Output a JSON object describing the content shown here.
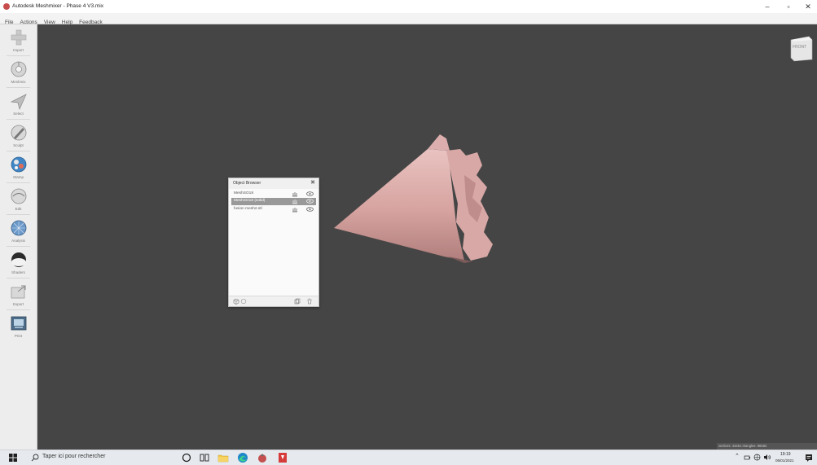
{
  "window": {
    "title": "Autodesk Meshmixer - Phase 4 V3.mix",
    "controls": [
      "–",
      "▫",
      "✕"
    ]
  },
  "menu": [
    "File",
    "Actions",
    "View",
    "Help",
    "Feedback"
  ],
  "tools": [
    {
      "label": "Import",
      "icon": "import-icon"
    },
    {
      "label": "Meshmix",
      "icon": "meshmix-icon"
    },
    {
      "label": "Select",
      "icon": "select-icon"
    },
    {
      "label": "Sculpt",
      "icon": "sculpt-icon"
    },
    {
      "label": "Stamp",
      "icon": "stamp-icon"
    },
    {
      "label": "Edit",
      "icon": "edit-icon"
    },
    {
      "label": "Analysis",
      "icon": "analysis-icon"
    },
    {
      "label": "Shaders",
      "icon": "shaders-icon"
    },
    {
      "label": "Export",
      "icon": "export-icon"
    },
    {
      "label": "Print",
      "icon": "print-icon"
    }
  ],
  "viewcube": {
    "label": "FRONT"
  },
  "object_browser": {
    "title": "Object Browser",
    "items": [
      {
        "name": "MeshSO18",
        "selected": false
      },
      {
        "name": "MeshSO18 (solid)",
        "selected": true
      },
      {
        "name": "fusion mesh2.stl",
        "selected": false
      }
    ]
  },
  "status": {
    "text": "vertices: 43451 triangles: 86582"
  },
  "taskbar": {
    "search_placeholder": "Taper ici pour rechercher",
    "time": "19:19",
    "date": "05/01/2021"
  },
  "colors": {
    "viewport": "#454545",
    "mesh": "#d9a7a5",
    "selection": "#999999"
  }
}
